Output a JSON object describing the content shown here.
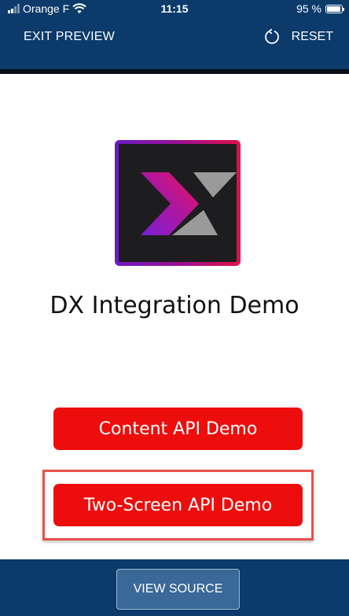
{
  "status_bar": {
    "carrier": "Orange F",
    "time": "11:15",
    "battery": "95 %"
  },
  "header": {
    "exit_label": "EXIT PREVIEW",
    "reset_label": "RESET",
    "reset_icon": "refresh-icon"
  },
  "main": {
    "logo": "dx-logo",
    "title": "DX Integration Demo",
    "buttons": [
      {
        "label": "Content API Demo"
      },
      {
        "label": "Two-Screen API Demo"
      }
    ]
  },
  "footer": {
    "view_source_label": "VIEW SOURCE"
  },
  "colors": {
    "bar_background": "#0b3a6b",
    "button_red": "#ee0d0d",
    "highlight": "#e8524a",
    "view_source_button": "#3a6897"
  }
}
